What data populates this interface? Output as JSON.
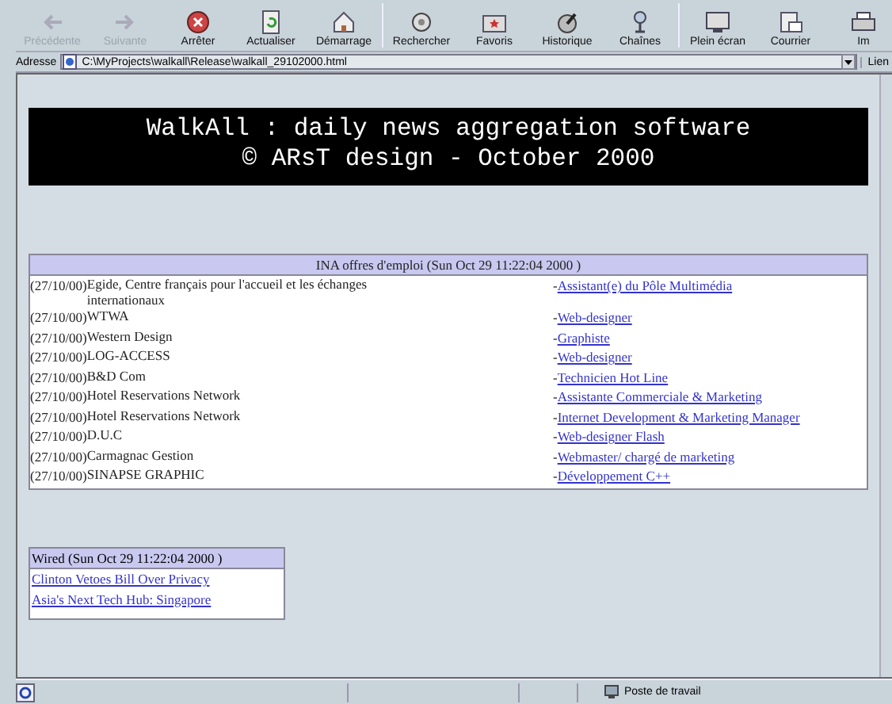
{
  "toolbar": {
    "buttons": [
      {
        "label": "Précédente",
        "disabled": true
      },
      {
        "label": "Suivante",
        "disabled": true
      },
      {
        "label": "Arrêter",
        "disabled": false
      },
      {
        "label": "Actualiser",
        "disabled": false
      },
      {
        "label": "Démarrage",
        "disabled": false
      },
      {
        "label": "Rechercher",
        "disabled": false
      },
      {
        "label": "Favoris",
        "disabled": false
      },
      {
        "label": "Historique",
        "disabled": false
      },
      {
        "label": "Chaînes",
        "disabled": false
      },
      {
        "label": "Plein écran",
        "disabled": false
      },
      {
        "label": "Courrier",
        "disabled": false
      },
      {
        "label": "Im",
        "disabled": false
      }
    ]
  },
  "address_bar": {
    "label": "Adresse",
    "value": "C:\\MyProjects\\walkall\\Release\\walkall_29102000.html",
    "links_label": "Lien"
  },
  "banner": {
    "lines": [
      "WalkAll : daily news aggregation software",
      "© ARsT design - October 2000"
    ]
  },
  "job_table": {
    "title": "INA offres d'emploi (Sun Oct 29 11:22:04 2000 )",
    "rows": [
      {
        "date": "(27/10/00)",
        "company": "Egide, Centre français pour l'accueil et les échanges internationaux",
        "bullet": "-",
        "job": "Assistant(e) du Pôle Multimédia"
      },
      {
        "date": "(27/10/00)",
        "company": "WTWA",
        "bullet": "-",
        "job": "Web-designer"
      },
      {
        "date": "(27/10/00)",
        "company": "Western Design",
        "bullet": "-",
        "job": "Graphiste"
      },
      {
        "date": "(27/10/00)",
        "company": "LOG-ACCESS",
        "bullet": "-",
        "job": "Web-designer"
      },
      {
        "date": "(27/10/00)",
        "company": "B&D Com",
        "bullet": "-",
        "job": "Technicien Hot Line"
      },
      {
        "date": "(27/10/00)",
        "company": "Hotel Reservations Network",
        "bullet": "-",
        "job": "Assistante Commerciale & Marketing"
      },
      {
        "date": "(27/10/00)",
        "company": "Hotel Reservations Network",
        "bullet": "-",
        "job": "Internet Development & Marketing Manager"
      },
      {
        "date": "(27/10/00)",
        "company": "D.U.C",
        "bullet": "-",
        "job": "Web-designer Flash"
      },
      {
        "date": "(27/10/00)",
        "company": "Carmagnac Gestion",
        "bullet": "-",
        "job": "Webmaster/ chargé de marketing"
      },
      {
        "date": "(27/10/00)",
        "company": "SINAPSE GRAPHIC",
        "bullet": "-",
        "job": "Développement C++"
      }
    ]
  },
  "news_box": {
    "title": "Wired (Sun Oct 29 11:22:04 2000 )",
    "links": [
      "Clinton Vetoes Bill Over Privacy",
      "Asia's Next Tech Hub: Singapore"
    ]
  },
  "status_bar": {
    "zone": "Poste de travail"
  }
}
